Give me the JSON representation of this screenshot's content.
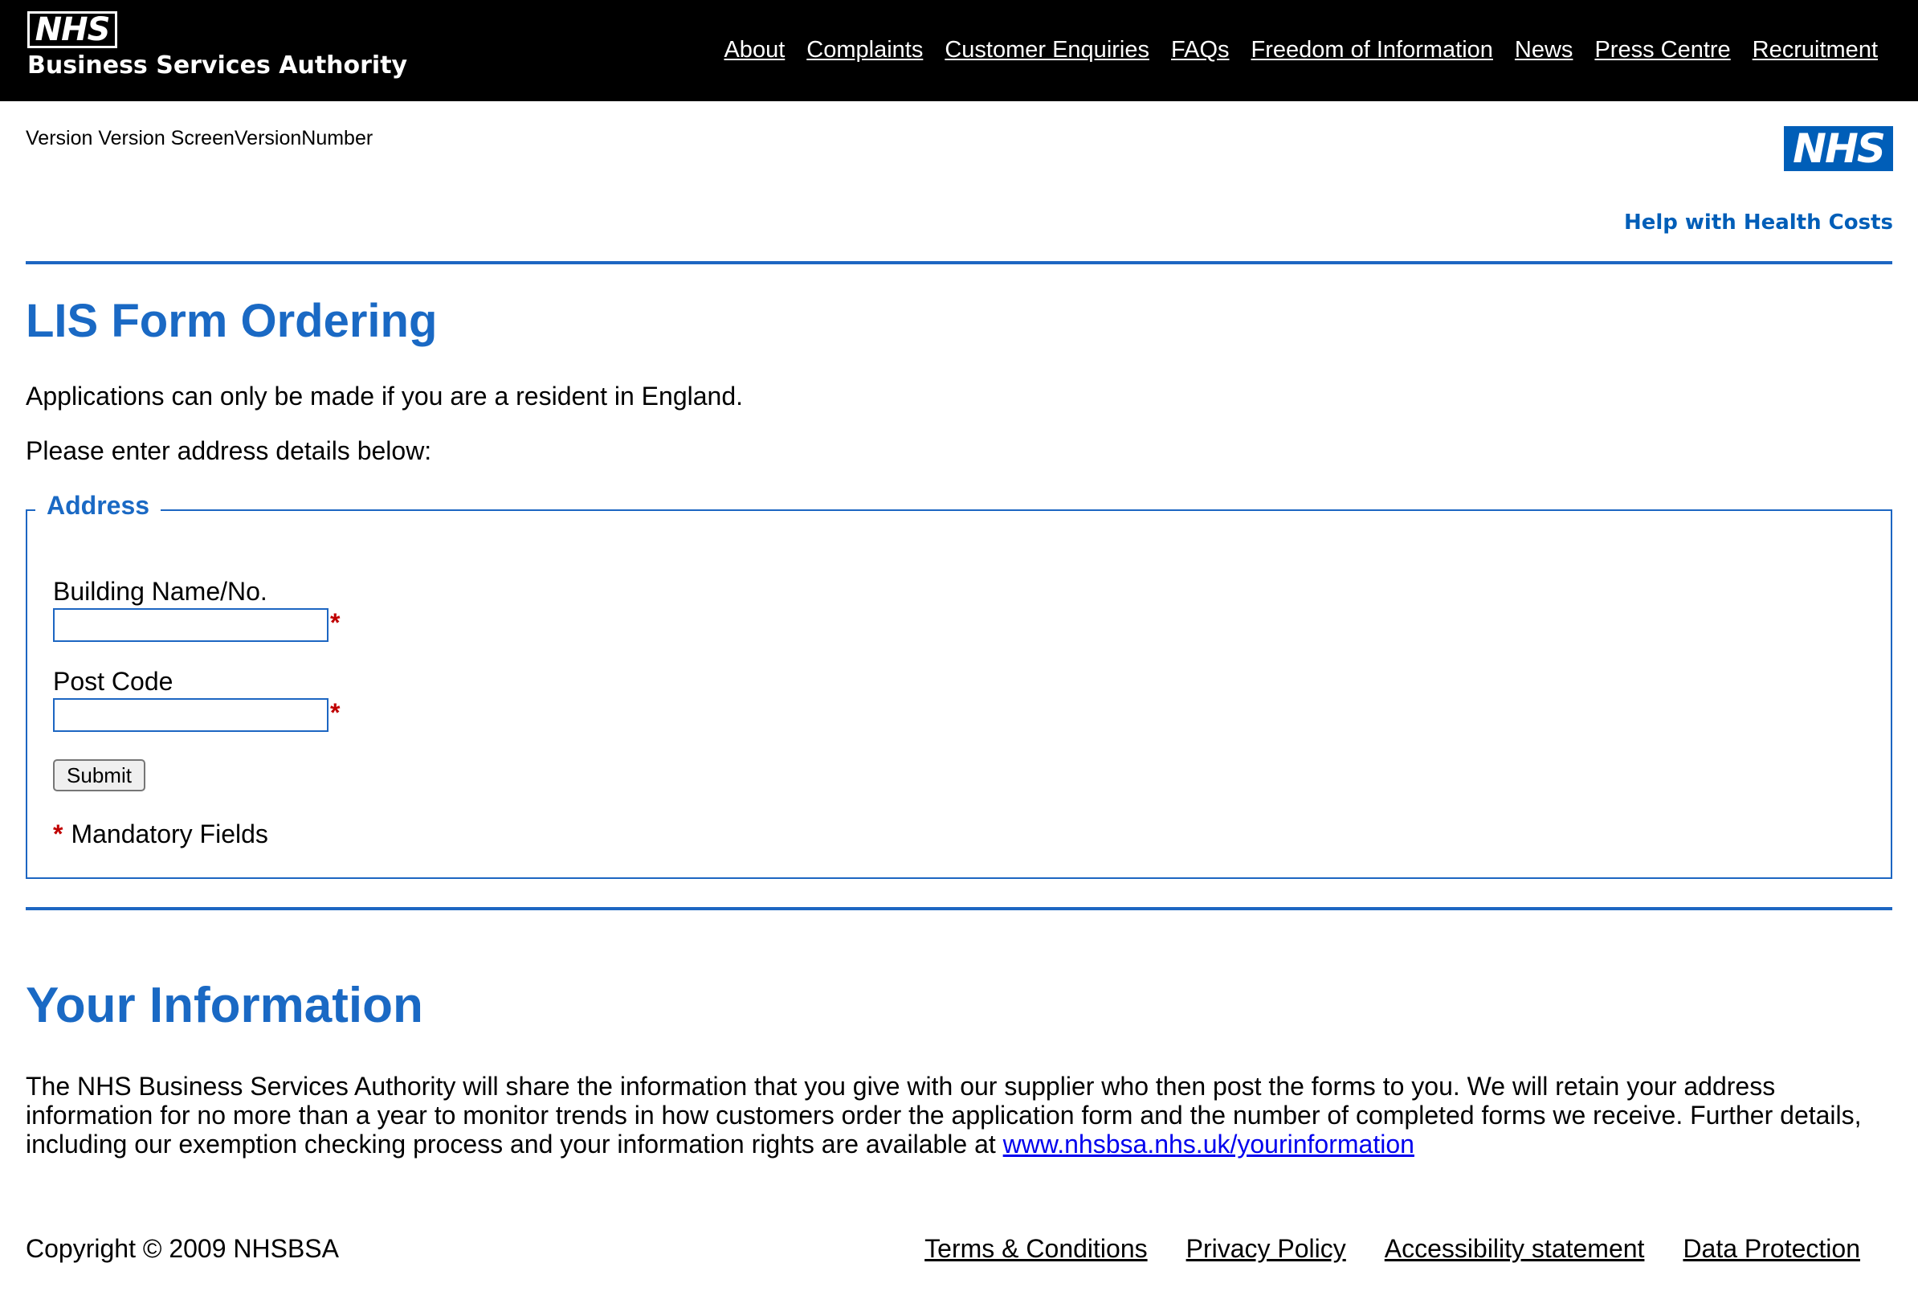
{
  "header": {
    "logo_text": "NHS",
    "org_name": "Business Services Authority",
    "nav": [
      "About",
      "Complaints",
      "Customer Enquiries",
      "FAQs",
      "Freedom of Information",
      "News",
      "Press Centre",
      "Recruitment"
    ]
  },
  "version_text": "Version Version ScreenVersionNumber",
  "brand": {
    "logo_text": "NHS",
    "caption": "Help with Health Costs",
    "accent_color": "#005eb8"
  },
  "main": {
    "title": "LIS Form Ordering",
    "intro": "Applications can only be made if you are a resident in England.",
    "instruction": "Please enter address details below:"
  },
  "address_form": {
    "legend": "Address",
    "building_label": "Building Name/No.",
    "building_value": "",
    "postcode_label": "Post Code",
    "postcode_value": "",
    "required_marker": "*",
    "submit_label": "Submit",
    "mandatory_text": "Mandatory Fields"
  },
  "your_information": {
    "title": "Your Information",
    "text": "The NHS Business Services Authority will share the information that you give with our supplier who then post the forms to you. We will retain your address information for no more than a year to monitor trends in how customers order the application form and the number of completed forms we receive. Further details, including our exemption checking process and your information rights are available at ",
    "link": "www.nhsbsa.nhs.uk/yourinformation"
  },
  "footer": {
    "copyright": "Copyright © 2009 NHSBSA",
    "links": [
      "Terms & Conditions",
      "Privacy Policy",
      "Accessibility statement",
      "Data Protection"
    ]
  }
}
